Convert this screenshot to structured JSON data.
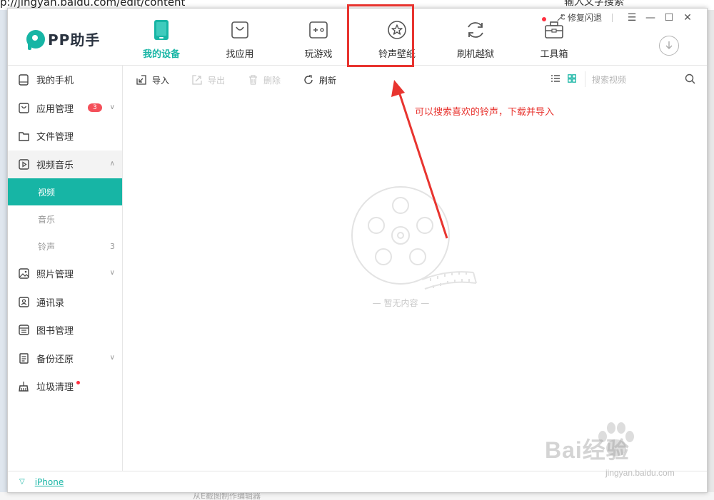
{
  "browser": {
    "url": "p://jingyan.baidu.com/edit/content",
    "search_placeholder": "输入文字搜索",
    "bottom_text": "从E截图制作编辑器"
  },
  "app": {
    "logo": "PP助手",
    "window_controls": {
      "repair": "修复闪退"
    },
    "nav": [
      {
        "label": "我的设备",
        "icon": "phone-icon",
        "active": true
      },
      {
        "label": "找应用",
        "icon": "bag-icon"
      },
      {
        "label": "玩游戏",
        "icon": "gamepad-icon"
      },
      {
        "label": "铃声壁纸",
        "icon": "star-icon"
      },
      {
        "label": "刷机越狱",
        "icon": "refresh-icon"
      },
      {
        "label": "工具箱",
        "icon": "toolbox-icon"
      }
    ],
    "sidebar": {
      "items": [
        {
          "label": "我的手机"
        },
        {
          "label": "应用管理",
          "badge": "3"
        },
        {
          "label": "文件管理"
        },
        {
          "label": "视频音乐"
        },
        {
          "label": "照片管理"
        },
        {
          "label": "通讯录"
        },
        {
          "label": "图书管理"
        },
        {
          "label": "备份还原"
        },
        {
          "label": "垃圾清理"
        }
      ],
      "sub_items": [
        {
          "label": "视频",
          "active": true
        },
        {
          "label": "音乐"
        },
        {
          "label": "铃声",
          "count": "3"
        }
      ]
    },
    "toolbar": {
      "import": "导入",
      "export": "导出",
      "delete": "删除",
      "refresh": "刷新",
      "search_placeholder": "搜索视频"
    },
    "empty_text": "— 暂无内容 —",
    "status": {
      "device": "iPhone"
    }
  },
  "annotation": {
    "text": "可以搜索喜欢的铃声，下载并导入",
    "color": "#e8342f"
  },
  "watermark": {
    "text": "Bai经验",
    "url": "jingyan.baidu.com"
  },
  "colors": {
    "accent": "#17b5a5",
    "badge": "#f4505a"
  }
}
